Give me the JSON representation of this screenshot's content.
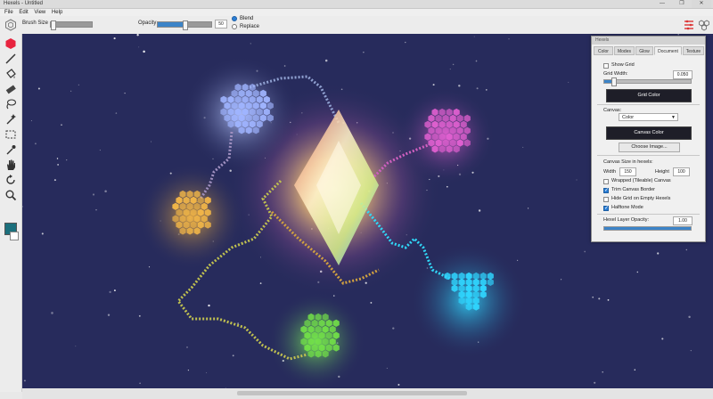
{
  "window": {
    "title": "Hexels - Untitled",
    "minimize": "—",
    "maximize": "❐",
    "close": "✕"
  },
  "menu": [
    "File",
    "Edit",
    "View",
    "Help"
  ],
  "toolbar": {
    "brush_size_label": "Brush Size",
    "opacity_label": "Opacity",
    "opacity_value": "50",
    "opacity_fraction": 0.5,
    "blend_label": "Blend",
    "replace_label": "Replace",
    "blend_selected": true
  },
  "tools": [
    {
      "name": "hexel-brush-tool",
      "icon": "hexagon-icon"
    },
    {
      "name": "line-tool",
      "icon": "line-icon"
    },
    {
      "name": "fill-tool",
      "icon": "paint-bucket-icon"
    },
    {
      "name": "eraser-tool",
      "icon": "eraser-icon"
    },
    {
      "name": "lasso-tool",
      "icon": "lasso-icon"
    },
    {
      "name": "magic-wand-tool",
      "icon": "magic-wand-icon"
    },
    {
      "name": "marquee-tool",
      "icon": "marquee-icon"
    },
    {
      "name": "eyedropper-tool",
      "icon": "eyedropper-icon"
    },
    {
      "name": "hand-tool",
      "icon": "hand-icon"
    },
    {
      "name": "rotate-tool",
      "icon": "rotate-icon"
    },
    {
      "name": "zoom-tool",
      "icon": "magnifier-icon"
    }
  ],
  "colors": {
    "primary": "#1b6f7c",
    "secondary": "#ffffff",
    "canvas_bg": "#272b5c",
    "accent": "#2a7ed6"
  },
  "panel": {
    "title": "Hexels",
    "tabs": [
      "Color",
      "Modes",
      "Glow",
      "Document",
      "Texture"
    ],
    "active_tab": "Document",
    "show_grid_label": "Show Grid",
    "show_grid": false,
    "grid_width_label": "Grid Width:",
    "grid_width_value": "0.050",
    "grid_width_fraction": 0.1,
    "grid_color_button": "Grid Color",
    "canvas_label": "Canvas:",
    "canvas_mode": "Color",
    "canvas_color_button": "Canvas Color",
    "choose_image_button": "Choose Image...",
    "canvas_size_label": "Canvas Size in hexels:",
    "width_label": "Width",
    "width_value": "150",
    "height_label": "Height",
    "height_value": "100",
    "wrapped_label": "Wrapped (Tileable) Canvas",
    "wrapped": false,
    "trim_label": "Trim Canvas Border",
    "trim": true,
    "hide_grid_label": "Hide Grid on Empty Hexels",
    "hide_grid": false,
    "halftone_label": "Halftone Mode",
    "halftone": true,
    "layer_opacity_label": "Hexel Layer Opacity:",
    "layer_opacity_value": "1.00",
    "layer_opacity_fraction": 1.0
  }
}
